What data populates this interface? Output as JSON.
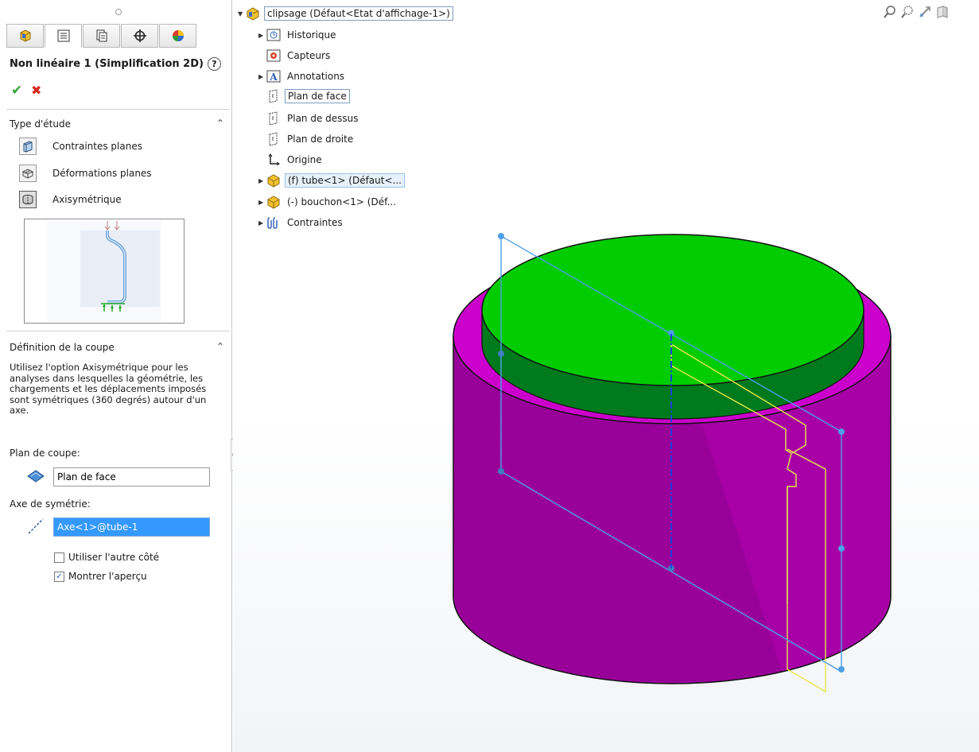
{
  "left_panel": {
    "title": "Non linéaire 1 (Simplification 2D)",
    "help": "?",
    "tabs": [
      "feature-manager-icon",
      "property-manager-icon",
      "configuration-manager-icon",
      "dimxpert-icon",
      "display-manager-icon"
    ],
    "ok_glyph": "✔",
    "cancel_glyph": "✖",
    "study_type": {
      "heading": "Type d'étude",
      "collapse_glyph": "⌃",
      "options": [
        {
          "label": "Contraintes planes",
          "icon": "plane-stress-icon"
        },
        {
          "label": "Déformations planes",
          "icon": "plane-strain-icon"
        },
        {
          "label": "Axisymétrique",
          "icon": "axisymmetric-icon",
          "selected": true
        }
      ]
    },
    "section_def": {
      "heading": "Définition de la coupe",
      "collapse_glyph": "⌃",
      "description": "Utilisez l'option Axisymétrique pour les analyses dans lesquelles la géométrie, les chargements et les déplacements imposés sont symétriques (360 degrés) autour d'un axe.",
      "plane_label": "Plan de coupe:",
      "plane_value": "Plan de face",
      "axis_label": "Axe de symétrie:",
      "axis_value": "Axe<1>@tube-1",
      "use_other_side": {
        "label": "Utiliser l'autre côté",
        "checked": false
      },
      "show_preview": {
        "label": "Montrer l'aperçu",
        "checked": true,
        "glyph": "✓"
      }
    }
  },
  "tree": {
    "root": {
      "label": "clipsage  (Défaut<Etat d'affichage-1>)",
      "arrow": "▼"
    },
    "items": [
      {
        "label": "Historique",
        "arrow": "▶",
        "icon": "history-icon"
      },
      {
        "label": "Capteurs",
        "arrow": "",
        "icon": "sensor-icon"
      },
      {
        "label": "Annotations",
        "arrow": "▶",
        "icon": "annotation-icon"
      },
      {
        "label": "Plan de face",
        "arrow": "",
        "icon": "plane-icon",
        "highlight": true
      },
      {
        "label": "Plan de dessus",
        "arrow": "",
        "icon": "plane-icon"
      },
      {
        "label": "Plan de droite",
        "arrow": "",
        "icon": "plane-icon"
      },
      {
        "label": "Origine",
        "arrow": "",
        "icon": "origin-icon"
      },
      {
        "label": "(f) tube<1> (Défaut<...",
        "arrow": "▶",
        "icon": "part-icon",
        "highlight": true
      },
      {
        "label": "(-) bouchon<1> (Déf...",
        "arrow": "▶",
        "icon": "part-icon"
      },
      {
        "label": "Contraintes",
        "arrow": "▶",
        "icon": "mates-icon"
      }
    ]
  },
  "toolbar_icons": [
    "zoom-to-fit-icon",
    "zoom-area-icon",
    "previous-view-icon",
    "section-view-icon"
  ],
  "colors": {
    "cap_green": "#00cc00",
    "tube_magenta": "#cc00cc",
    "plane_blue": "#4d9fe8",
    "section_yellow": "#e8e84a",
    "axis_blue": "#1a3fe0"
  }
}
